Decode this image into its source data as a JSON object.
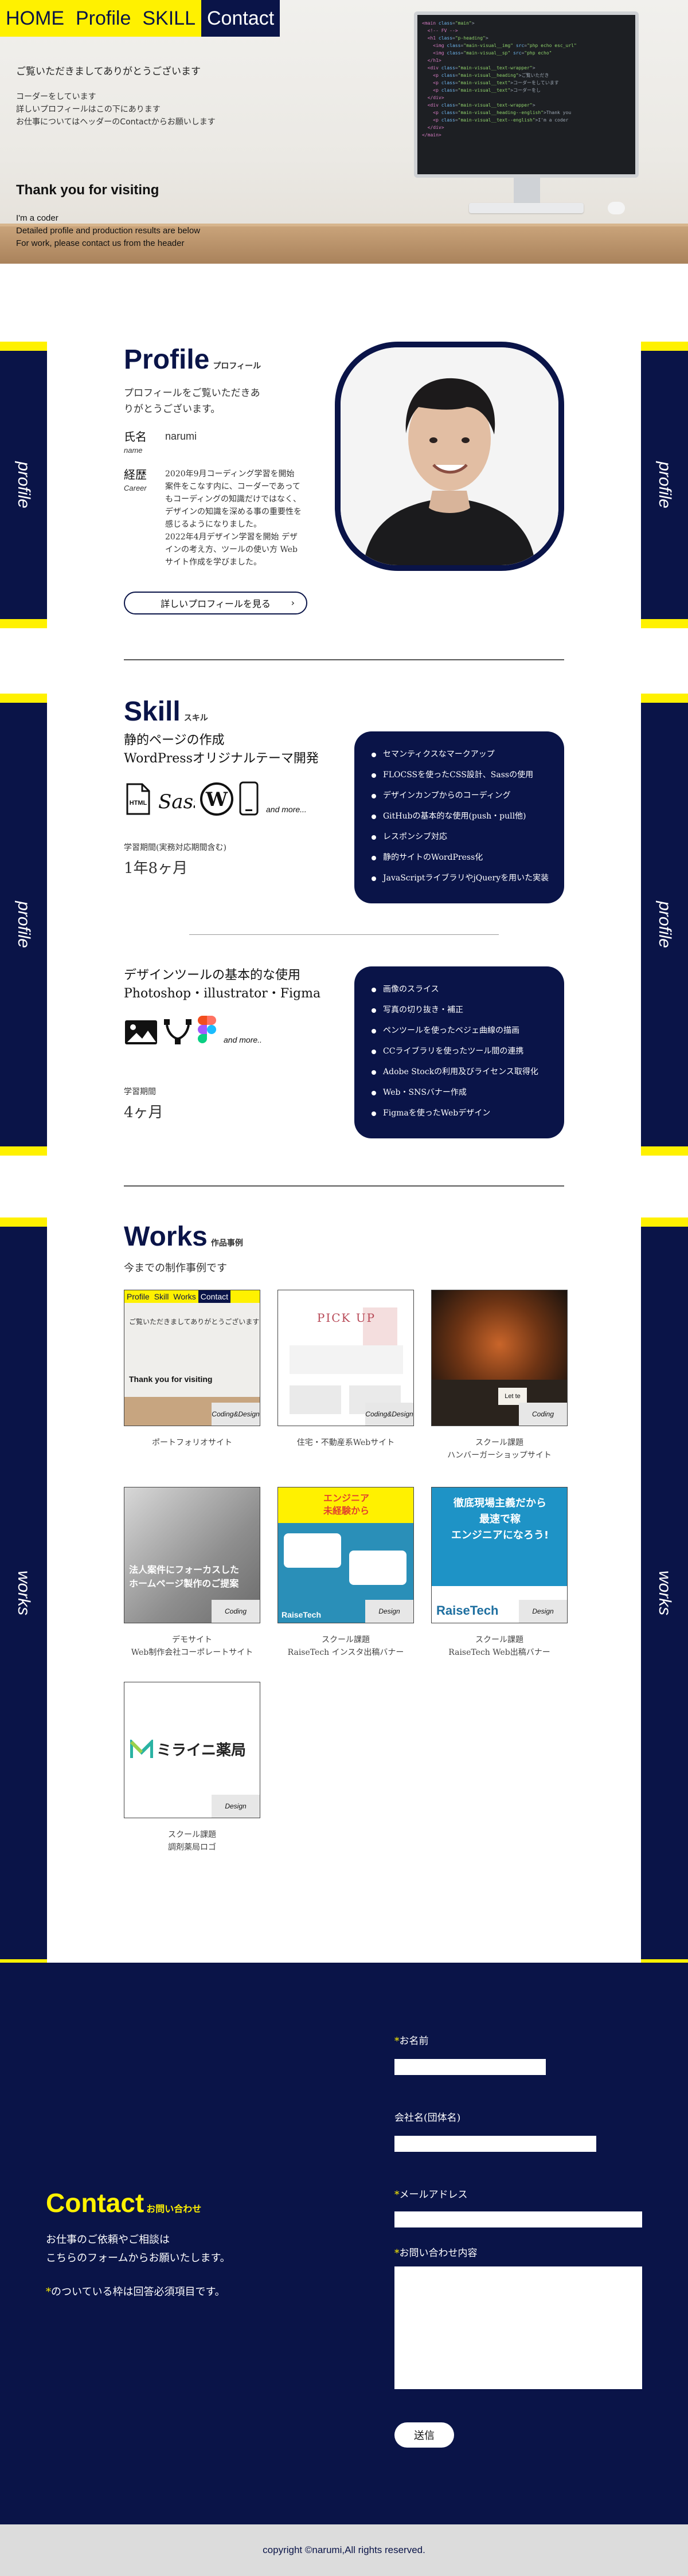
{
  "nav": {
    "items": [
      {
        "label": "HOME",
        "active": false
      },
      {
        "label": "Profile",
        "active": false
      },
      {
        "label": "SKILL",
        "active": false
      },
      {
        "label": "Contact",
        "active": true
      }
    ]
  },
  "hero": {
    "greeting": "ご覧いただきましてありがとうございます",
    "lines": [
      "コーダーをしています",
      "詳しいプロフィールはこの下にあります",
      "お仕事についてはヘッダーのContactからお願いします"
    ],
    "title": "Thank you for visiting",
    "en_lines": [
      "I'm a coder",
      "Detailed profile and production results are below",
      "For work, please contact us from the header"
    ]
  },
  "bands": {
    "profile": "profile",
    "works": "works"
  },
  "profile": {
    "title": "Profile",
    "title_jp": "プロフィール",
    "intro": "プロフィールをご覧いただきありがとうございます。",
    "name_label_jp": "氏名",
    "name_label_en": "name",
    "name_value": "narumi",
    "career_label_jp": "経歴",
    "career_label_en": "Career",
    "career_text_1": "2020年9月コーディング学習を開始 案件をこなす内に、コーダーであってもコーディングの知識だけではなく、デザインの知識を深める事の重要性を感じるようになりました。",
    "career_text_2": "2022年4月デザイン学習を開始 デザインの考え方、ツールの使い方 Webサイト作成を学びました。",
    "more_button": "詳しいプロフィールを見る",
    "more_icon": "chevron-right-icon"
  },
  "skill": {
    "title": "Skill",
    "title_jp": "スキル",
    "coding": {
      "heading_1": "静的ページの作成",
      "heading_2": "WordPressオリジナルテーマ開発",
      "icons": [
        "html-file-icon",
        "sass-logo-icon",
        "wordpress-logo-icon",
        "smartphone-icon"
      ],
      "more": "and more...",
      "period_label": "学習期間(実務対応期間含む)",
      "period": "1年8ヶ月",
      "list": [
        "セマンティクスなマークアップ",
        "FLOCSSを使ったCSS設計、Sassの使用",
        "デザインカンプからのコーディング",
        "GitHubの基本的な使用(push・pull他)",
        "レスポンシブ対応",
        "静的サイトのWordPress化",
        "JavaScriptライブラリやjQueryを用いた実装"
      ]
    },
    "design": {
      "heading_1": "デザインツールの基本的な使用",
      "heading_2": "Photoshop・illustrator・Figma",
      "icons": [
        "image-icon",
        "vector-pen-icon",
        "figma-logo-icon"
      ],
      "more": "and more..",
      "period_label": "学習期間",
      "period": "4ヶ月",
      "list": [
        "画像のスライス",
        "写真の切り抜き・補正",
        "ペンツールを使ったベジェ曲線の描画",
        "CCライブラリを使ったツール間の連携",
        "Adobe Stockの利用及びライセンス取得化",
        "Web・SNSバナー作成",
        "Figmaを使ったWebデザイン"
      ]
    }
  },
  "works": {
    "title": "Works",
    "title_jp": "作品事例",
    "subtitle": "今までの制作事例です",
    "items": [
      {
        "tag": "Coding&Design",
        "caption": "ポートフォリオサイト",
        "thumb_nav": [
          "Profile",
          "Skill",
          "Works",
          "Contact"
        ],
        "thumb_text": "ご覧いただきましてありがとうございます",
        "thumb_title": "Thank you for visiting"
      },
      {
        "tag": "Coding&Design",
        "caption": "住宅・不動産系Webサイト",
        "thumb_title": "PICK UP"
      },
      {
        "tag": "Coding",
        "caption": "スクール課題\nハンバーガーショップサイト",
        "thumb_text": "Let te"
      },
      {
        "tag": "Coding",
        "caption": "デモサイト\nWeb制作会社コーポレートサイト",
        "thumb_text": "法人案件にフォーカスした\nホームページ製作のご提案"
      },
      {
        "tag": "Design",
        "caption": "スクール課題\nRaiseTech インスタ出稿バナー",
        "thumb_text": "エンジニア\n未経験から",
        "thumb_title": "RaiseTech"
      },
      {
        "tag": "Design",
        "caption": "スクール課題\nRaiseTech Web出稿バナー",
        "thumb_text": "徹底現場主義だから\n最速で稼\nエンジニアになろう!",
        "thumb_title": "RaiseTech"
      },
      {
        "tag": "Design",
        "caption": "スクール課題\n調剤薬局ロゴ",
        "thumb_text": "ミライニ薬局"
      }
    ]
  },
  "contact": {
    "title": "Contact",
    "title_jp": "お問い合わせ",
    "description": "お仕事のご依頼やご相談は\nこちらのフォームからお願いたします。",
    "note": "のついている枠は回答必須項目です。",
    "fields": [
      {
        "label": "お名前",
        "required": true
      },
      {
        "label": "会社名(団体名)",
        "required": false
      },
      {
        "label": "メールアドレス",
        "required": true
      },
      {
        "label": "お問い合わせ内容",
        "required": true
      }
    ],
    "submit": "送信"
  },
  "footer": {
    "copyright": "copyright ©narumi,All rights reserved."
  },
  "colors": {
    "navy": "#0a1448",
    "yellow": "#fff100"
  }
}
